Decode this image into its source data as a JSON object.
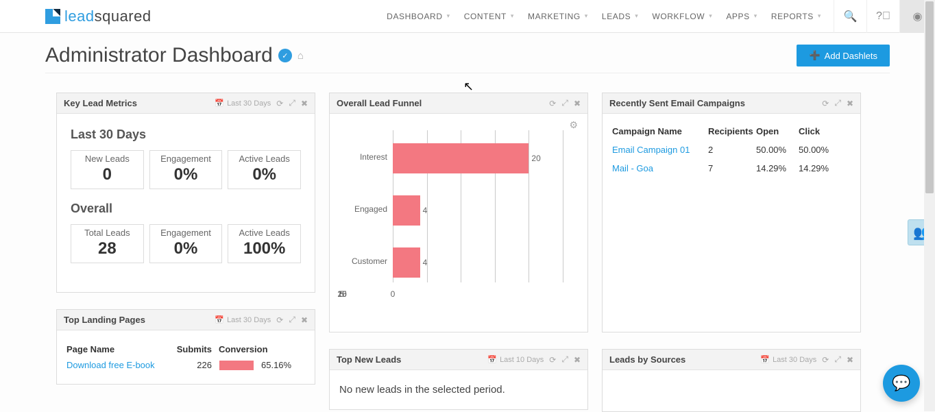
{
  "brand": {
    "a": "lead",
    "b": "squared"
  },
  "nav": [
    "DASHBOARD",
    "CONTENT",
    "MARKETING",
    "LEADS",
    "WORKFLOW",
    "APPS",
    "REPORTS"
  ],
  "page": {
    "title": "Administrator Dashboard",
    "add_btn": "Add Dashlets"
  },
  "kl": {
    "title": "Key Lead Metrics",
    "range": "Last 30 Days",
    "sec1": "Last 30 Days",
    "sec2": "Overall",
    "m": [
      {
        "lbl": "New Leads",
        "val": "0"
      },
      {
        "lbl": "Engagement",
        "val": "0%"
      },
      {
        "lbl": "Active Leads",
        "val": "0%"
      },
      {
        "lbl": "Total Leads",
        "val": "28"
      },
      {
        "lbl": "Engagement",
        "val": "0%"
      },
      {
        "lbl": "Active Leads",
        "val": "100%"
      }
    ]
  },
  "funnel": {
    "title": "Overall Lead Funnel"
  },
  "chart_data": {
    "type": "bar",
    "orientation": "horizontal",
    "categories": [
      "Interest",
      "Engaged",
      "Customer"
    ],
    "values": [
      20,
      4,
      4
    ],
    "xticks": [
      0,
      5,
      10,
      15,
      20,
      25
    ],
    "xlim": [
      0,
      25
    ],
    "color": "#f37881"
  },
  "emails": {
    "title": "Recently Sent Email Campaigns",
    "cols": [
      "Campaign Name",
      "Recipients",
      "Open",
      "Click"
    ],
    "rows": [
      {
        "name": "Email Campaign 01",
        "rec": "2",
        "open": "50.00%",
        "click": "50.00%"
      },
      {
        "name": "Mail - Goa",
        "rec": "7",
        "open": "14.29%",
        "click": "14.29%"
      }
    ]
  },
  "lp": {
    "title": "Top Landing Pages",
    "range": "Last 30 Days",
    "cols": [
      "Page Name",
      "Submits",
      "Conversion"
    ],
    "rows": [
      {
        "name": "Download free E-book",
        "submits": "226",
        "conv": "65.16%"
      }
    ]
  },
  "nl": {
    "title": "Top New Leads",
    "range": "Last 10 Days",
    "msg": "No new leads in the selected period."
  },
  "ls": {
    "title": "Leads by Sources",
    "range": "Last 30 Days"
  }
}
